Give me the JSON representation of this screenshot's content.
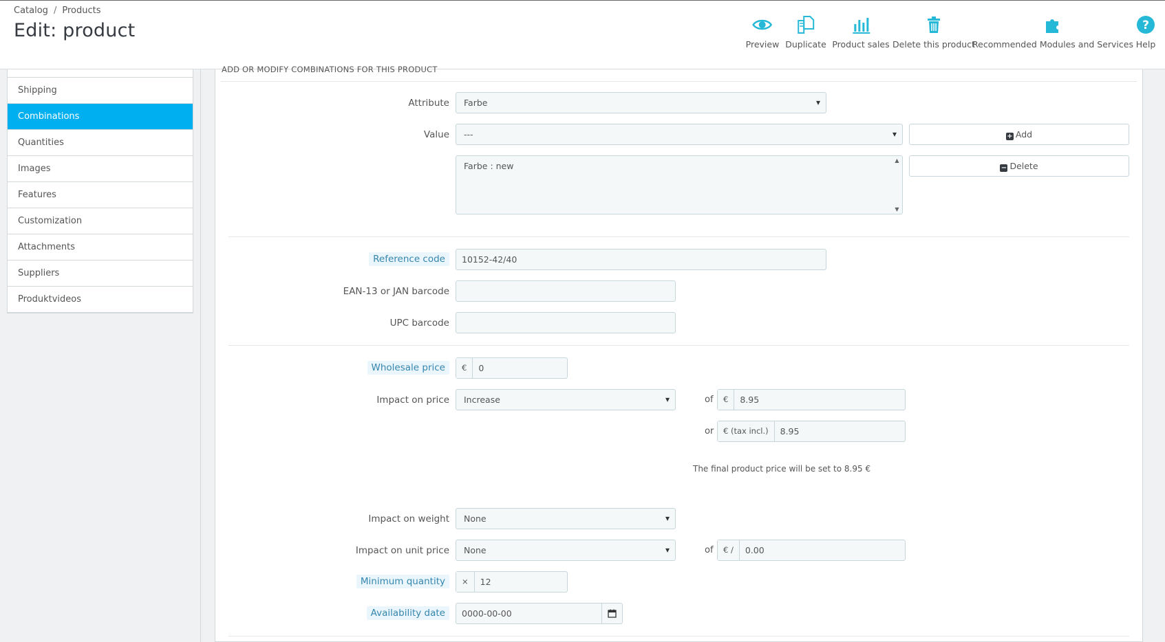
{
  "breadcrumb": {
    "catalog": "Catalog",
    "separator": "/",
    "products": "Products"
  },
  "page_title": "Edit: product",
  "toolbar": {
    "preview": "Preview",
    "duplicate": "Duplicate",
    "product_sales": "Product sales",
    "delete": "Delete this product",
    "modules": "Recommended Modules and Services",
    "help": "Help"
  },
  "sidebar": {
    "items": [
      {
        "label": "Shipping"
      },
      {
        "label": "Combinations"
      },
      {
        "label": "Quantities"
      },
      {
        "label": "Images"
      },
      {
        "label": "Features"
      },
      {
        "label": "Customization"
      },
      {
        "label": "Attachments"
      },
      {
        "label": "Suppliers"
      },
      {
        "label": "Produktvideos"
      }
    ],
    "active": "Combinations"
  },
  "panel": {
    "heading": "ADD OR MODIFY COMBINATIONS FOR THIS PRODUCT",
    "attribute_label": "Attribute",
    "attribute_value": "Farbe",
    "value_label": "Value",
    "value_value": "---",
    "add_button": "Add",
    "delete_button": "Delete",
    "combination_list": [
      "Farbe : new"
    ],
    "reference_label": "Reference code",
    "reference_value": "10152-42/40",
    "ean_label": "EAN-13 or JAN barcode",
    "ean_value": "",
    "upc_label": "UPC barcode",
    "upc_value": "",
    "wholesale_label": "Wholesale price",
    "wholesale_currency": "€",
    "wholesale_value": "0",
    "impact_price_label": "Impact on price",
    "impact_price_value": "Increase",
    "of_label": "of",
    "or_label": "or",
    "price_currency": "€",
    "price_value": "8.95",
    "price_tax_currency": "€ (tax incl.)",
    "price_tax_value": "8.95",
    "final_price_text": "The final product price will be set to 8.95 €",
    "impact_weight_label": "Impact on weight",
    "impact_weight_value": "None",
    "impact_unit_label": "Impact on unit price",
    "impact_unit_value": "None",
    "unit_of_label": "of",
    "unit_currency": "€ /",
    "unit_value": "0.00",
    "min_qty_label": "Minimum quantity",
    "min_qty_prefix": "×",
    "min_qty_value": "12",
    "availability_label": "Availability date",
    "availability_value": "0000-00-00"
  },
  "colors": {
    "accent": "#00aff0",
    "icon": "#25b9d7",
    "hint_bg": "#eaf6fc",
    "hint_text": "#3586ae"
  }
}
